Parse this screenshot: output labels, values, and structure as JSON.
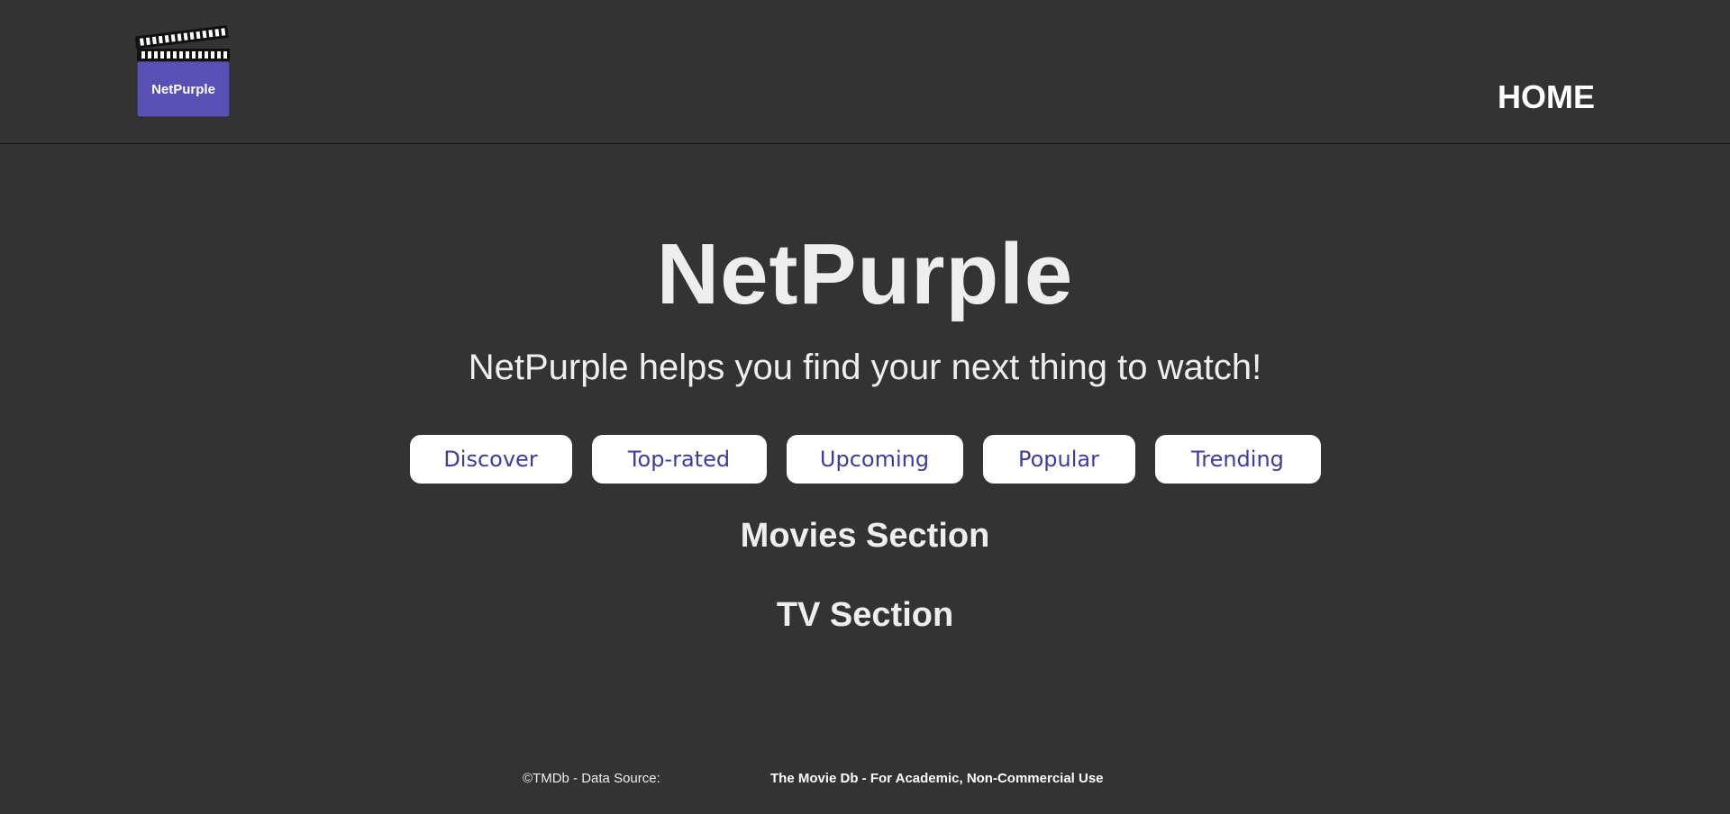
{
  "header": {
    "logo_text": "NetPurple",
    "nav_home": "HOME"
  },
  "hero": {
    "title": "NetPurple",
    "subtitle": "NetPurple helps you find your next thing to watch!"
  },
  "buttons": [
    {
      "label": "Discover"
    },
    {
      "label": "Top-rated"
    },
    {
      "label": "Upcoming"
    },
    {
      "label": "Popular"
    },
    {
      "label": "Trending"
    }
  ],
  "sections": {
    "movies": "Movies Section",
    "tv": "TV Section"
  },
  "footer": {
    "copyright": "©TMDb - Data Source:",
    "source_link": "The Movie Db - For Academic, Non-Commercial Use"
  },
  "colors": {
    "background": "#333333",
    "brand_purple": "#5a4fb5",
    "button_text": "#3f3b9e"
  }
}
